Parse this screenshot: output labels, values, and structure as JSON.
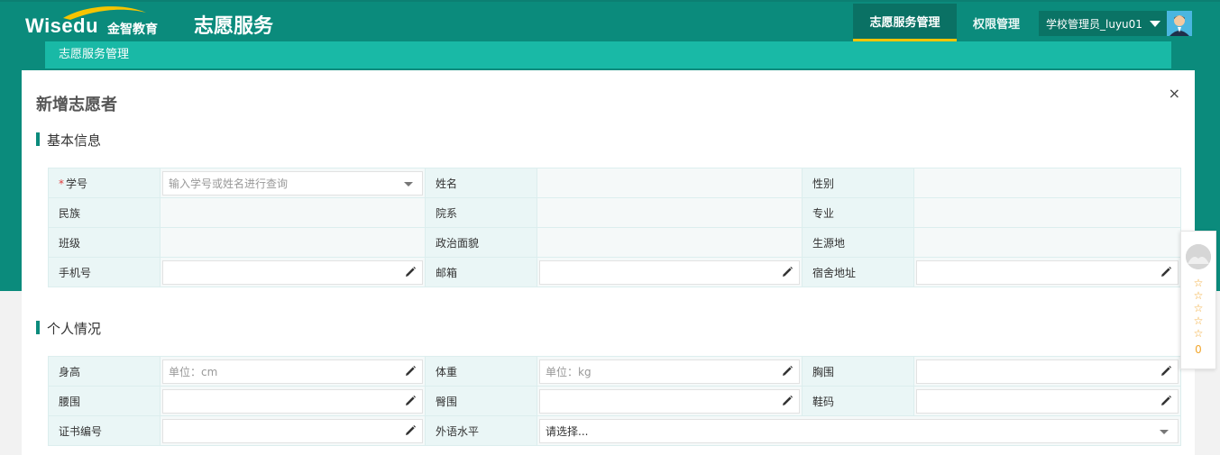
{
  "header": {
    "logo_text": "Wisedu",
    "logo_cn": "金智教育",
    "app_title": "志愿服务",
    "nav": [
      {
        "label": "志愿服务管理",
        "active": true
      },
      {
        "label": "权限管理",
        "active": false
      }
    ],
    "user": "学校管理员_luyu01"
  },
  "subnav": {
    "label": "志愿服务管理"
  },
  "modal": {
    "title": "新增志愿者",
    "close": "×",
    "section_basic": {
      "title": "基本信息",
      "rows": [
        [
          {
            "label": "学号",
            "required": true,
            "type": "select",
            "placeholder": "输入学号或姓名进行查询"
          },
          {
            "label": "姓名",
            "type": "static"
          },
          {
            "label": "性别",
            "type": "static"
          }
        ],
        [
          {
            "label": "民族",
            "type": "static"
          },
          {
            "label": "院系",
            "type": "static"
          },
          {
            "label": "专业",
            "type": "static"
          }
        ],
        [
          {
            "label": "班级",
            "type": "static"
          },
          {
            "label": "政治面貌",
            "type": "static"
          },
          {
            "label": "生源地",
            "type": "static"
          }
        ],
        [
          {
            "label": "手机号",
            "type": "text",
            "placeholder": ""
          },
          {
            "label": "邮箱",
            "type": "text",
            "placeholder": ""
          },
          {
            "label": "宿舍地址",
            "type": "text",
            "placeholder": ""
          }
        ]
      ]
    },
    "section_personal": {
      "title": "个人情况",
      "rows": [
        [
          {
            "label": "身高",
            "type": "text",
            "placeholder": "单位：cm"
          },
          {
            "label": "体重",
            "type": "text",
            "placeholder": "单位：kg"
          },
          {
            "label": "胸围",
            "type": "text",
            "placeholder": ""
          }
        ],
        [
          {
            "label": "腰围",
            "type": "text",
            "placeholder": ""
          },
          {
            "label": "臀围",
            "type": "text",
            "placeholder": ""
          },
          {
            "label": "鞋码",
            "type": "text",
            "placeholder": ""
          }
        ],
        [
          {
            "label": "证书编号",
            "type": "text",
            "placeholder": ""
          },
          {
            "label": "外语水平",
            "type": "select_wide",
            "value": "请选择..."
          }
        ]
      ]
    }
  },
  "side_widget": {
    "stars": [
      "☆",
      "☆",
      "☆",
      "☆",
      "☆"
    ],
    "count": "0"
  },
  "colors": {
    "primary": "#0b8b7c",
    "accent": "#19b9a6",
    "highlight": "#f6c400"
  }
}
